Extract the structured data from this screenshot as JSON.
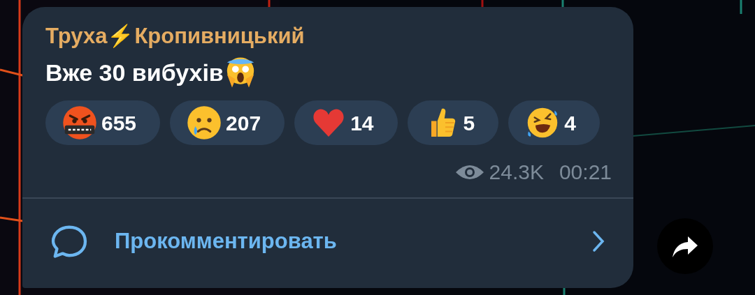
{
  "message": {
    "author": "Труха⚡Кропивницький",
    "text": "Вже 30 вибухів",
    "reactions": [
      {
        "kind": "cursing",
        "count": "655"
      },
      {
        "kind": "crying",
        "count": "207"
      },
      {
        "kind": "heart",
        "count": "14"
      },
      {
        "kind": "thumbs",
        "count": "5"
      },
      {
        "kind": "laughing",
        "count": "4"
      }
    ],
    "views": "24.3K",
    "time": "00:21",
    "comment_label": "Прокомментировать"
  }
}
